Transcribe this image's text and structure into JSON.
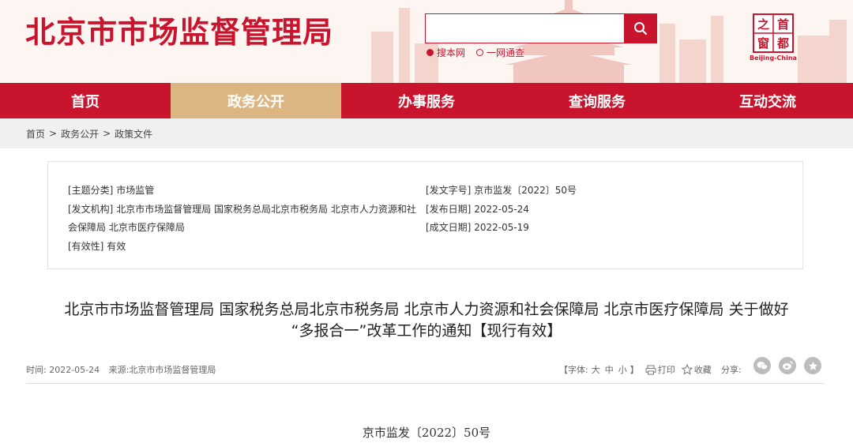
{
  "header": {
    "site_title": "北京市市场监督管理局",
    "search_placeholder": "",
    "search_options": [
      "搜本网",
      "一网通查"
    ],
    "selected_search_option": "搜本网",
    "logo_chars": [
      "首",
      "都",
      "之",
      "窗"
    ],
    "logo_caption": "Beijing-China"
  },
  "colors": {
    "brand_red": "#c8152d",
    "nav_active": "#dcb682",
    "breadcrumb_bg": "#f0f0f0"
  },
  "nav": {
    "items": [
      "首页",
      "政务公开",
      "办事服务",
      "查询服务",
      "互动交流"
    ],
    "active": "政务公开"
  },
  "breadcrumb": [
    "首页",
    "政务公开",
    "政策文件"
  ],
  "breadcrumb_sep": ">",
  "meta": {
    "topic_label": "[主题分类]",
    "topic_value": "市场监管",
    "issuer_label": "[发文机构]",
    "issuer_value": "北京市市场监督管理局 国家税务总局北京市税务局 北京市人力资源和社会保障局 北京市医疗保障局",
    "validity_label": "[有效性]",
    "validity_value": "有效",
    "doc_no_label": "[发文字号]",
    "doc_no_value": "京市监发〔2022〕50号",
    "publish_label": "[发布日期]",
    "publish_value": "2022-05-24",
    "created_label": "[成文日期]",
    "created_value": "2022-05-19"
  },
  "article": {
    "title_line1": "北京市市场监督管理局 国家税务总局北京市税务局 北京市人力资源和社会保障局 北京市医疗保障局 关于做好",
    "title_line2": "“多报合一”改革工作的通知【现行有效】",
    "time_text": "时间: 2022-05-24",
    "source_text": "来源:北京市市场监督管理局",
    "font_label_open": "【字体:",
    "font_sizes": [
      "大",
      "中",
      "小"
    ],
    "font_label_close": "】",
    "print_label": "打印",
    "favorite_label": "收藏",
    "share_label": "分享:",
    "share_icons": [
      "wechat-icon",
      "weibo-icon",
      "star-icon"
    ],
    "doc_number": "京市监发〔2022〕50号"
  }
}
